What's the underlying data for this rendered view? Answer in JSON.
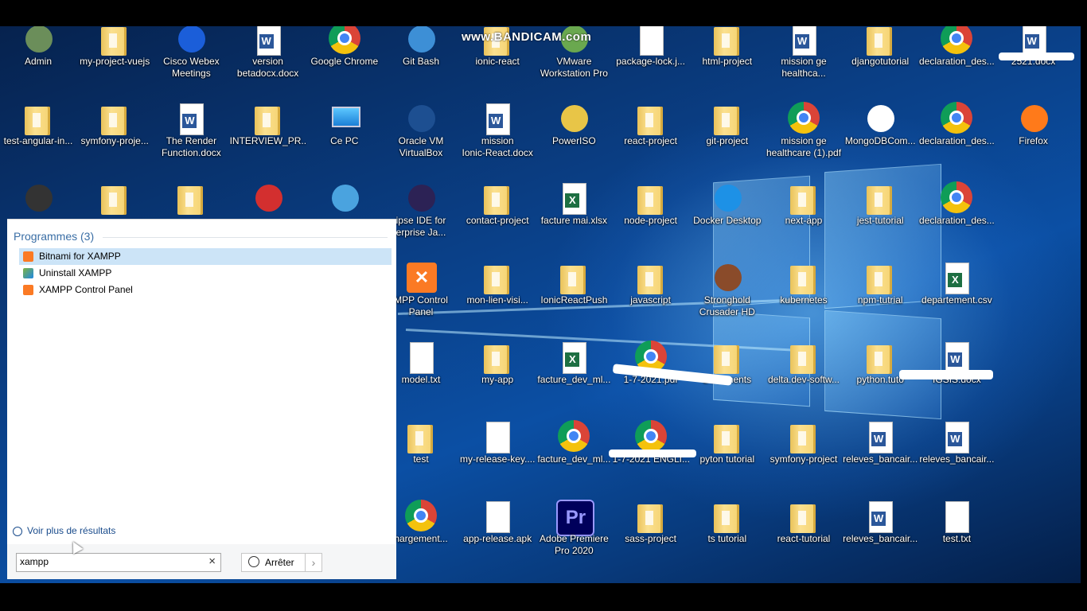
{
  "watermark": "www.BANDICAM.com",
  "colors": {
    "desktop": "#0b4fa4",
    "panel": "#ffffff",
    "selection": "#cce4f7",
    "link": "#3a6ea5"
  },
  "desktop_icons": [
    {
      "label": "Admin",
      "icon": "user-icon"
    },
    {
      "label": "my-project-vuejs",
      "icon": "folder-icon"
    },
    {
      "label": "Cisco Webex\nMeetings",
      "icon": "webex-icon"
    },
    {
      "label": "version\nbetadocx.docx",
      "icon": "word-icon"
    },
    {
      "label": "Google Chrome",
      "icon": "chrome-icon"
    },
    {
      "label": "Git Bash",
      "icon": "git-icon"
    },
    {
      "label": "ionic-react",
      "icon": "folder-icon"
    },
    {
      "label": "VMware\nWorkstation Pro",
      "icon": "vmware-icon"
    },
    {
      "label": "package-lock.j...",
      "icon": "json-icon"
    },
    {
      "label": "html-project",
      "icon": "folder-icon"
    },
    {
      "label": "mission ge\nhealthca...",
      "icon": "word-icon"
    },
    {
      "label": "djangotutorial",
      "icon": "folder-icon"
    },
    {
      "label": "declaration_des...",
      "icon": "chrome-icon"
    },
    {
      "label": "2521.docx",
      "icon": "word-icon"
    },
    {
      "label": "test-angular-in...",
      "icon": "folder-icon"
    },
    {
      "label": "symfony-proje...",
      "icon": "folder-icon"
    },
    {
      "label": "The Render\nFunction.docx",
      "icon": "word-icon"
    },
    {
      "label": "INTERVIEW_PR...",
      "icon": "folder-icon"
    },
    {
      "label": "Ce PC",
      "icon": "computer-icon"
    },
    {
      "label": "Oracle VM\nVirtualBox",
      "icon": "virtualbox-icon"
    },
    {
      "label": "mission\nIonic-React.docx",
      "icon": "word-icon"
    },
    {
      "label": "PowerISO",
      "icon": "disc-icon"
    },
    {
      "label": "react-project",
      "icon": "folder-icon"
    },
    {
      "label": "git-project",
      "icon": "folder-icon"
    },
    {
      "label": "mission ge\nhealthcare (1).pdf",
      "icon": "chrome-icon"
    },
    {
      "label": "MongoDBCom...",
      "icon": "mongodb-icon"
    },
    {
      "label": "declaration_des...",
      "icon": "chrome-icon"
    },
    {
      "label": "Firefox",
      "icon": "firefox-icon"
    },
    {
      "label": "",
      "icon": "video-editor-icon"
    },
    {
      "label": "",
      "icon": "rss-folder-icon"
    },
    {
      "label": "",
      "icon": "folder-icon"
    },
    {
      "label": "",
      "icon": "recorder-icon"
    },
    {
      "label": "",
      "icon": "network-icon"
    },
    {
      "label": "ipse IDE for\nerprise Ja...",
      "icon": "eclipse-icon"
    },
    {
      "label": "contact-project",
      "icon": "folder-icon"
    },
    {
      "label": "facture mai.xlsx",
      "icon": "excel-icon"
    },
    {
      "label": "node-project",
      "icon": "folder-icon"
    },
    {
      "label": "Docker Desktop",
      "icon": "docker-icon"
    },
    {
      "label": "next-app",
      "icon": "folder-icon"
    },
    {
      "label": "jest-tutorial",
      "icon": "folder-icon"
    },
    {
      "label": "declaration_des...",
      "icon": "chrome-icon"
    },
    {
      "label": "MPP Control\nPanel",
      "icon": "xampp-icon"
    },
    {
      "label": "mon-lien-visi...",
      "icon": "folder-icon"
    },
    {
      "label": "IonicReactPush",
      "icon": "folder-icon"
    },
    {
      "label": "javascript",
      "icon": "js-folder-icon"
    },
    {
      "label": "Stronghold\nCrusader HD",
      "icon": "game-icon"
    },
    {
      "label": "kubernetes",
      "icon": "folder-icon"
    },
    {
      "label": "npm-tutrial",
      "icon": "folder-icon"
    },
    {
      "label": "departement.csv",
      "icon": "excel-icon"
    },
    {
      "label": "model.txt",
      "icon": "text-icon"
    },
    {
      "label": "my-app",
      "icon": "folder-icon"
    },
    {
      "label": "facture_dev_ml...",
      "icon": "excel-icon"
    },
    {
      "label": "1-7-2021.pdf",
      "icon": "chrome-icon"
    },
    {
      "label": "Documents",
      "icon": "documents-icon"
    },
    {
      "label": "delta.dev-softw...",
      "icon": "folder-icon"
    },
    {
      "label": "python.tuto",
      "icon": "python-folder-icon"
    },
    {
      "label": "IGSIS.docx",
      "icon": "word-icon"
    },
    {
      "label": "test",
      "icon": "folder-icon"
    },
    {
      "label": "my-release-key....",
      "icon": "file-icon"
    },
    {
      "label": "facture_dev_ml...",
      "icon": "chrome-icon"
    },
    {
      "label": "1-7-2021 ENGLI...",
      "icon": "chrome-icon"
    },
    {
      "label": "pyton tutorial",
      "icon": "python-folder-icon"
    },
    {
      "label": "symfony-project",
      "icon": "folder-icon"
    },
    {
      "label": "releves_bancair...",
      "icon": "word-icon"
    },
    {
      "label": "releves_bancair...",
      "icon": "word-icon"
    },
    {
      "label": "hargement...",
      "icon": "chrome-icon"
    },
    {
      "label": "app-release.apk",
      "icon": "file-icon"
    },
    {
      "label": "Adobe Premiere\nPro 2020",
      "icon": "premiere-icon"
    },
    {
      "label": "sass-project",
      "icon": "folder-icon"
    },
    {
      "label": "ts tutorial",
      "icon": "ts-folder-icon"
    },
    {
      "label": "react-tutorial",
      "icon": "folder-icon"
    },
    {
      "label": "releves_bancair...",
      "icon": "word-icon"
    },
    {
      "label": "test.txt",
      "icon": "text-icon"
    }
  ],
  "search_panel": {
    "section_title": "Programmes (3)",
    "results": [
      {
        "label": "Bitnami for XAMPP",
        "icon": "xampp-icon",
        "selected": true
      },
      {
        "label": "Uninstall XAMPP",
        "icon": "uninstall-icon",
        "selected": false
      },
      {
        "label": "XAMPP Control Panel",
        "icon": "xampp-icon",
        "selected": false
      }
    ],
    "more_results": "Voir plus de résultats",
    "search_value": "xampp",
    "clear_glyph": "×",
    "shutdown_label": "Arrêter",
    "shutdown_arrow": "›"
  }
}
